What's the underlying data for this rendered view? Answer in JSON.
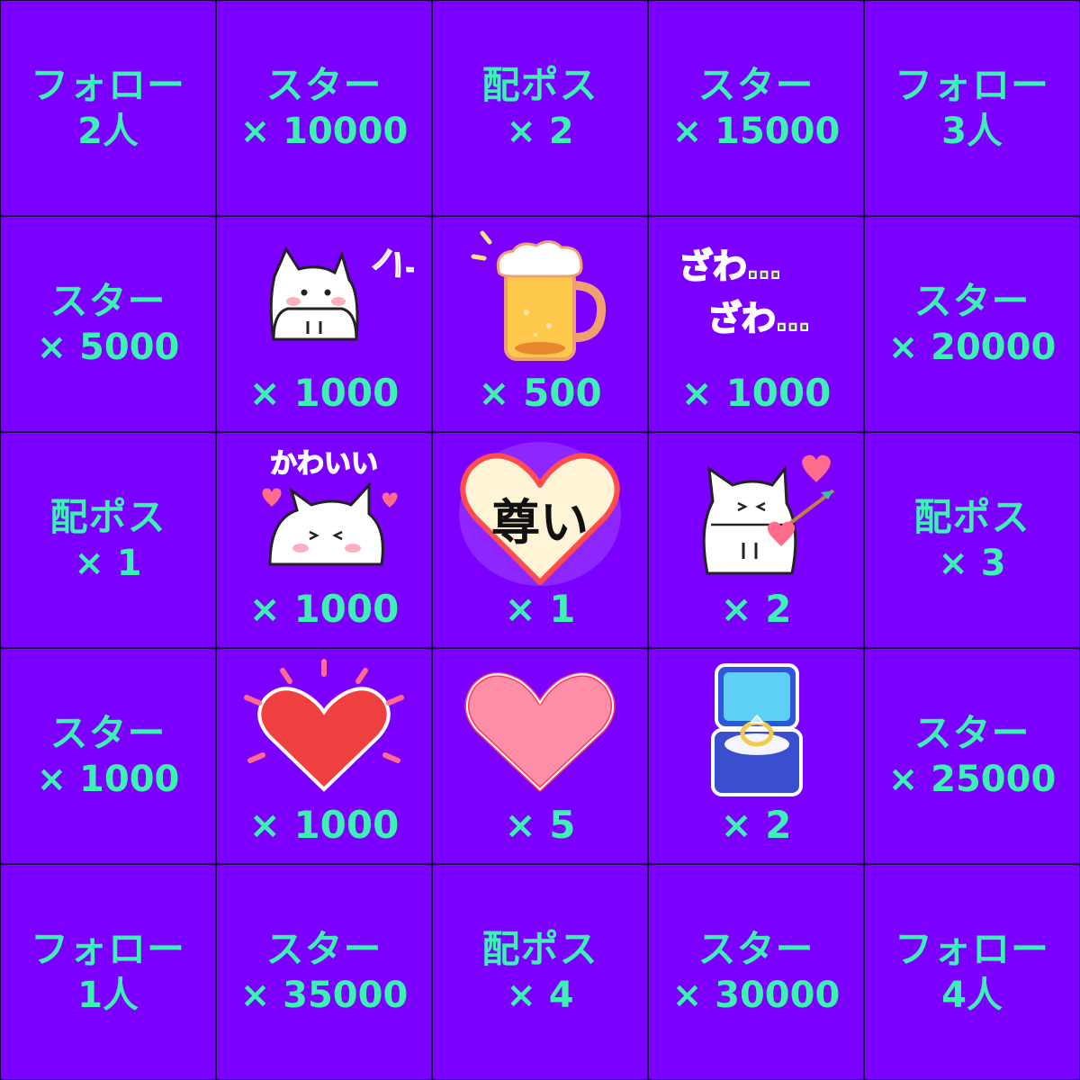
{
  "colors": {
    "cell_bg": "#7b00ff",
    "text": "#3df0b4",
    "grid_line": "#1a0040"
  },
  "cells": {
    "r1c1": {
      "line1": "フォロー",
      "line2": "2人"
    },
    "r1c2": {
      "line1": "スター",
      "line2": "× 10000"
    },
    "r1c3": {
      "line1": "配ポス",
      "line2": "× 2"
    },
    "r1c4": {
      "line1": "スター",
      "line2": "× 15000"
    },
    "r1c5": {
      "line1": "フォロー",
      "line2": "3人"
    },
    "r2c1": {
      "line1": "スター",
      "line2": "× 5000"
    },
    "r2c2": {
      "icon": "cat-hai-sticker",
      "sticker_text": "ハイ！",
      "qty": "× 1000"
    },
    "r2c3": {
      "icon": "beer-mug-sticker",
      "qty": "× 500"
    },
    "r2c4": {
      "icon": "zawazawa-sticker",
      "sticker_text_1": "ざわ…",
      "sticker_text_2": "ざわ…",
      "qty": "× 1000"
    },
    "r2c5": {
      "line1": "スター",
      "line2": "× 20000"
    },
    "r3c1": {
      "line1": "配ポス",
      "line2": "× 1"
    },
    "r3c2": {
      "icon": "cat-kawaii-sticker",
      "sticker_text": "かわいい",
      "qty": "× 1000"
    },
    "r3c3": {
      "icon": "toutoi-heart-sticker",
      "sticker_text": "尊い",
      "qty": "× 1"
    },
    "r3c4": {
      "icon": "cat-cupid-sticker",
      "qty": "× 2"
    },
    "r3c5": {
      "line1": "配ポス",
      "line2": "× 3"
    },
    "r4c1": {
      "line1": "スター",
      "line2": "× 1000"
    },
    "r4c2": {
      "icon": "red-heart-sticker",
      "qty": "× 1000"
    },
    "r4c3": {
      "icon": "pink-heart-sticker",
      "qty": "× 5"
    },
    "r4c4": {
      "icon": "ring-box-sticker",
      "qty": "× 2"
    },
    "r4c5": {
      "line1": "スター",
      "line2": "× 25000"
    },
    "r5c1": {
      "line1": "フォロー",
      "line2": "1人"
    },
    "r5c2": {
      "line1": "スター",
      "line2": "× 35000"
    },
    "r5c3": {
      "line1": "配ポス",
      "line2": "× 4"
    },
    "r5c4": {
      "line1": "スター",
      "line2": "× 30000"
    },
    "r5c5": {
      "line1": "フォロー",
      "line2": "4人"
    }
  }
}
